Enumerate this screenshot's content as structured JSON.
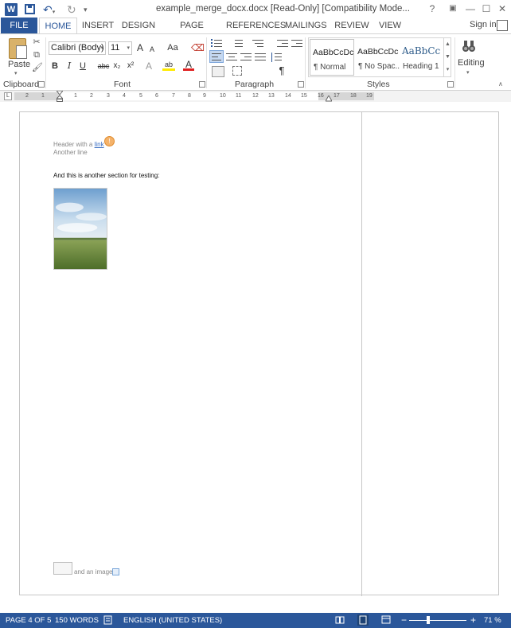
{
  "window": {
    "title": "example_merge_docx.docx [Read-Only] [Compatibility Mode...",
    "help": "?"
  },
  "tabs": [
    "FILE",
    "HOME",
    "INSERT",
    "DESIGN",
    "PAGE LAYOUT",
    "REFERENCES",
    "MAILINGS",
    "REVIEW",
    "VIEW"
  ],
  "signin": "Sign in",
  "ribbon": {
    "clipboard": {
      "label": "Clipboard",
      "paste": "Paste"
    },
    "font": {
      "label": "Font",
      "name": "Calibri (Body)",
      "size": "11",
      "bold": "B",
      "italic": "I",
      "underline": "U",
      "strike": "abc",
      "subscript": "x₂",
      "superscript": "x²",
      "grow": "A",
      "shrink": "A",
      "change_case": "Aa",
      "text_effects": "A",
      "highlight": "ab",
      "font_color": "A"
    },
    "paragraph": {
      "label": "Paragraph",
      "pilcrow": "¶"
    },
    "styles": {
      "label": "Styles",
      "items": [
        {
          "sample": "AaBbCcDc",
          "name": "¶ Normal"
        },
        {
          "sample": "AaBbCcDc",
          "name": "¶ No Spac..."
        },
        {
          "sample": "AaBbCc",
          "name": "Heading 1"
        }
      ]
    },
    "editing": {
      "label": "Editing"
    }
  },
  "ruler": {
    "numbers": [
      "2",
      "1",
      "1",
      "2",
      "3",
      "4",
      "5",
      "6",
      "7",
      "8",
      "9",
      "10",
      "11",
      "12",
      "13",
      "14",
      "15",
      "16",
      "17",
      "18",
      "19"
    ]
  },
  "document": {
    "header_prefix": "Header with a ",
    "header_link": "link",
    "another_line": "Another line",
    "section_text": "And this is another section for testing:",
    "footer_text": "and an image"
  },
  "status": {
    "page": "PAGE 4 OF 5",
    "words": "150 WORDS",
    "language": "ENGLISH (UNITED STATES)",
    "zoom_minus": "−",
    "zoom_plus": "+",
    "zoom": "71 %"
  },
  "colors": {
    "accent": "#2b579a",
    "link": "#3c6fc2",
    "comment": "#f4b26a"
  }
}
